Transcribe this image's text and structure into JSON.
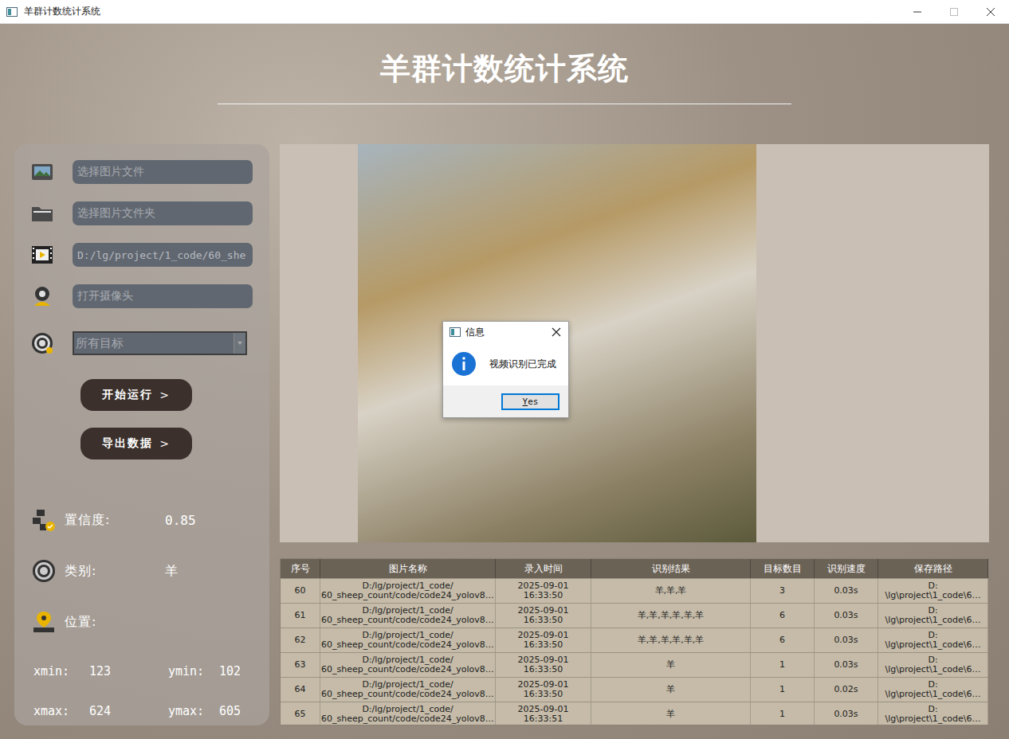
{
  "window": {
    "title": "羊群计数统计系统"
  },
  "header": {
    "title": "羊群计数统计系统"
  },
  "inputs": [
    {
      "name": "image-file",
      "text": "选择图片文件",
      "filled": false
    },
    {
      "name": "image-folder",
      "text": "选择图片文件夹",
      "filled": false
    },
    {
      "name": "video-file",
      "text": "D:/lg/project/1_code/60_she",
      "filled": true
    },
    {
      "name": "camera",
      "text": "打开摄像头",
      "filled": false
    }
  ],
  "target_select": {
    "value": "所有目标"
  },
  "buttons": [
    {
      "label": "开始运行",
      "arrow": ">"
    },
    {
      "label": "导出数据",
      "arrow": ">"
    }
  ],
  "result": {
    "confidence_label": "置信度:",
    "confidence": "0.85",
    "class_label": "类别:",
    "class": "羊",
    "position_label": "位置:",
    "coords": [
      {
        "label": "xmin:",
        "value": "123"
      },
      {
        "label": "ymin:",
        "value": "102"
      },
      {
        "label": "xmax:",
        "value": "624"
      },
      {
        "label": "ymax:",
        "value": "605"
      }
    ]
  },
  "dialog": {
    "title": "信息",
    "message": "视频识别已完成",
    "button": "Yes"
  },
  "table": {
    "columns": [
      "序号",
      "图片名称",
      "录入时间",
      "识别结果",
      "目标数目",
      "识别速度",
      "保存路径"
    ],
    "rows": [
      {
        "index": "60",
        "name": [
          "D:/lg/project/1_code/",
          "60_sheep_count/code/code24_yolov8…"
        ],
        "time": [
          "2025-09-01",
          "16:33:50"
        ],
        "result": "羊,羊,羊",
        "count": "3",
        "speed": "0.03s",
        "path": [
          "D:",
          "\\lg\\project\\1_code\\6…"
        ]
      },
      {
        "index": "61",
        "name": [
          "D:/lg/project/1_code/",
          "60_sheep_count/code/code24_yolov8…"
        ],
        "time": [
          "2025-09-01",
          "16:33:50"
        ],
        "result": "羊,羊,羊,羊,羊,羊",
        "count": "6",
        "speed": "0.03s",
        "path": [
          "D:",
          "\\lg\\project\\1_code\\6…"
        ]
      },
      {
        "index": "62",
        "name": [
          "D:/lg/project/1_code/",
          "60_sheep_count/code/code24_yolov8…"
        ],
        "time": [
          "2025-09-01",
          "16:33:50"
        ],
        "result": "羊,羊,羊,羊,羊,羊",
        "count": "6",
        "speed": "0.03s",
        "path": [
          "D:",
          "\\lg\\project\\1_code\\6…"
        ]
      },
      {
        "index": "63",
        "name": [
          "D:/lg/project/1_code/",
          "60_sheep_count/code/code24_yolov8…"
        ],
        "time": [
          "2025-09-01",
          "16:33:50"
        ],
        "result": "羊",
        "count": "1",
        "speed": "0.03s",
        "path": [
          "D:",
          "\\lg\\project\\1_code\\6…"
        ]
      },
      {
        "index": "64",
        "name": [
          "D:/lg/project/1_code/",
          "60_sheep_count/code/code24_yolov8…"
        ],
        "time": [
          "2025-09-01",
          "16:33:50"
        ],
        "result": "羊",
        "count": "1",
        "speed": "0.02s",
        "path": [
          "D:",
          "\\lg\\project\\1_code\\6…"
        ]
      },
      {
        "index": "65",
        "name": [
          "D:/lg/project/1_code/",
          "60_sheep_count/code/code24_yolov8…"
        ],
        "time": [
          "2025-09-01",
          "16:33:51"
        ],
        "result": "羊",
        "count": "1",
        "speed": "0.03s",
        "path": [
          "D:",
          "\\lg\\project\\1_code\\6…"
        ]
      }
    ]
  }
}
